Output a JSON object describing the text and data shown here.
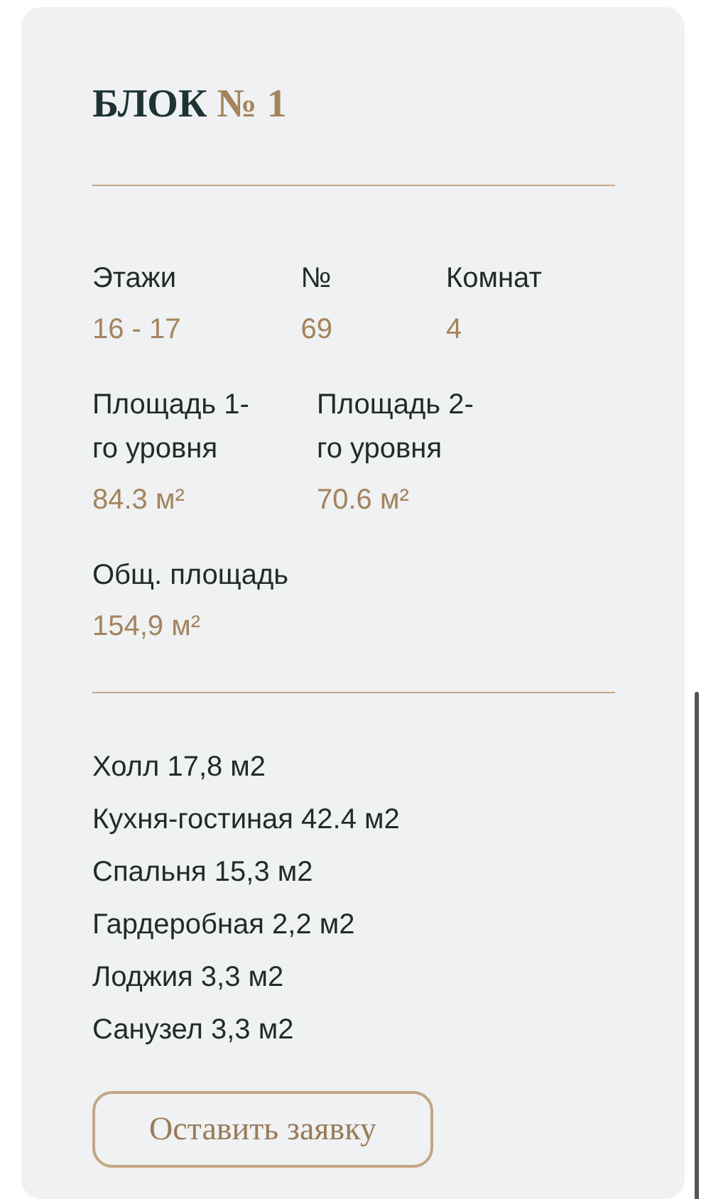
{
  "title": {
    "text": "БЛОК",
    "number": "№ 1"
  },
  "stats": [
    {
      "label": "Этажи",
      "value": "16 - 17"
    },
    {
      "label": "№",
      "value": "69"
    },
    {
      "label": "Комнат",
      "value": "4"
    }
  ],
  "areas": [
    {
      "label": "Площадь 1-го уровня",
      "value": "84.3 м²"
    },
    {
      "label": "Площадь 2-го уровня",
      "value": "70.6 м²"
    }
  ],
  "total": {
    "label": "Общ. площадь",
    "value": "154,9 м²"
  },
  "rooms": [
    "Холл 17,8 м2",
    "Кухня-гостиная 42.4 м2",
    "Спальня 15,3 м2",
    "Гардеробная 2,2 м2",
    "Лоджия 3,3 м2",
    "Санузел 3,3 м2"
  ],
  "button": "Оставить заявку"
}
